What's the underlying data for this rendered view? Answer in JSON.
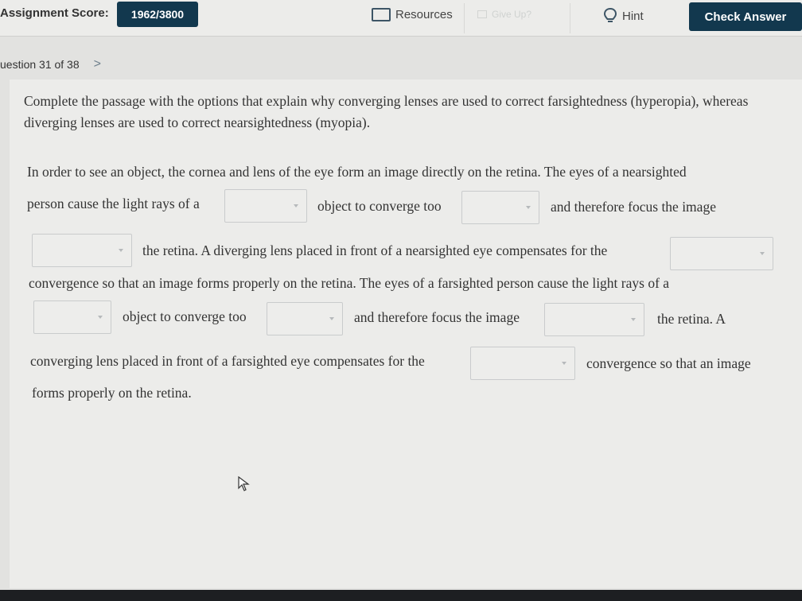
{
  "toolbar": {
    "score_label": "Assignment Score:",
    "score_value": "1962/3800",
    "resources_label": "Resources",
    "resources_icon": "resources-icon",
    "giveup_label": "Give Up?",
    "hint_label": "Hint",
    "hint_icon": "lightbulb-icon",
    "check_label": "Check Answer"
  },
  "question_nav": {
    "label": "uestion 31 of 38",
    "next_icon": "chevron-right-icon",
    "next_glyph": ">"
  },
  "instructions": "Complete the passage with the options that explain why converging lenses are used to correct farsightedness (hyperopia), whereas diverging lenses are used to correct nearsightedness (myopia).",
  "passage": {
    "line1": "In order to see an object, the cornea and lens of the eye form an image directly on the retina. The eyes of a nearsighted",
    "line2a": "person cause the light rays of a",
    "line2b": "object to converge too",
    "line2c": "and therefore focus the image",
    "line3a": "the retina. A diverging lens placed in front of a nearsighted eye compensates for the",
    "line4": "convergence so that an image forms properly on the retina. The eyes of a farsighted person cause the light rays of a",
    "line5a": "object to converge too",
    "line5b": "and therefore focus the image",
    "line5c": "the retina. A",
    "line6a": "converging lens placed in front of a farsighted eye compensates for the",
    "line6b": "convergence so that an image",
    "line7": "forms properly on the retina."
  },
  "dropdowns": {
    "blank1": "",
    "blank2": "",
    "blank3": "",
    "blank4": "",
    "blank5": "",
    "blank6": "",
    "blank7": "",
    "blank8": ""
  },
  "colors": {
    "accent": "#12384e",
    "background": "#e2e2e0"
  }
}
